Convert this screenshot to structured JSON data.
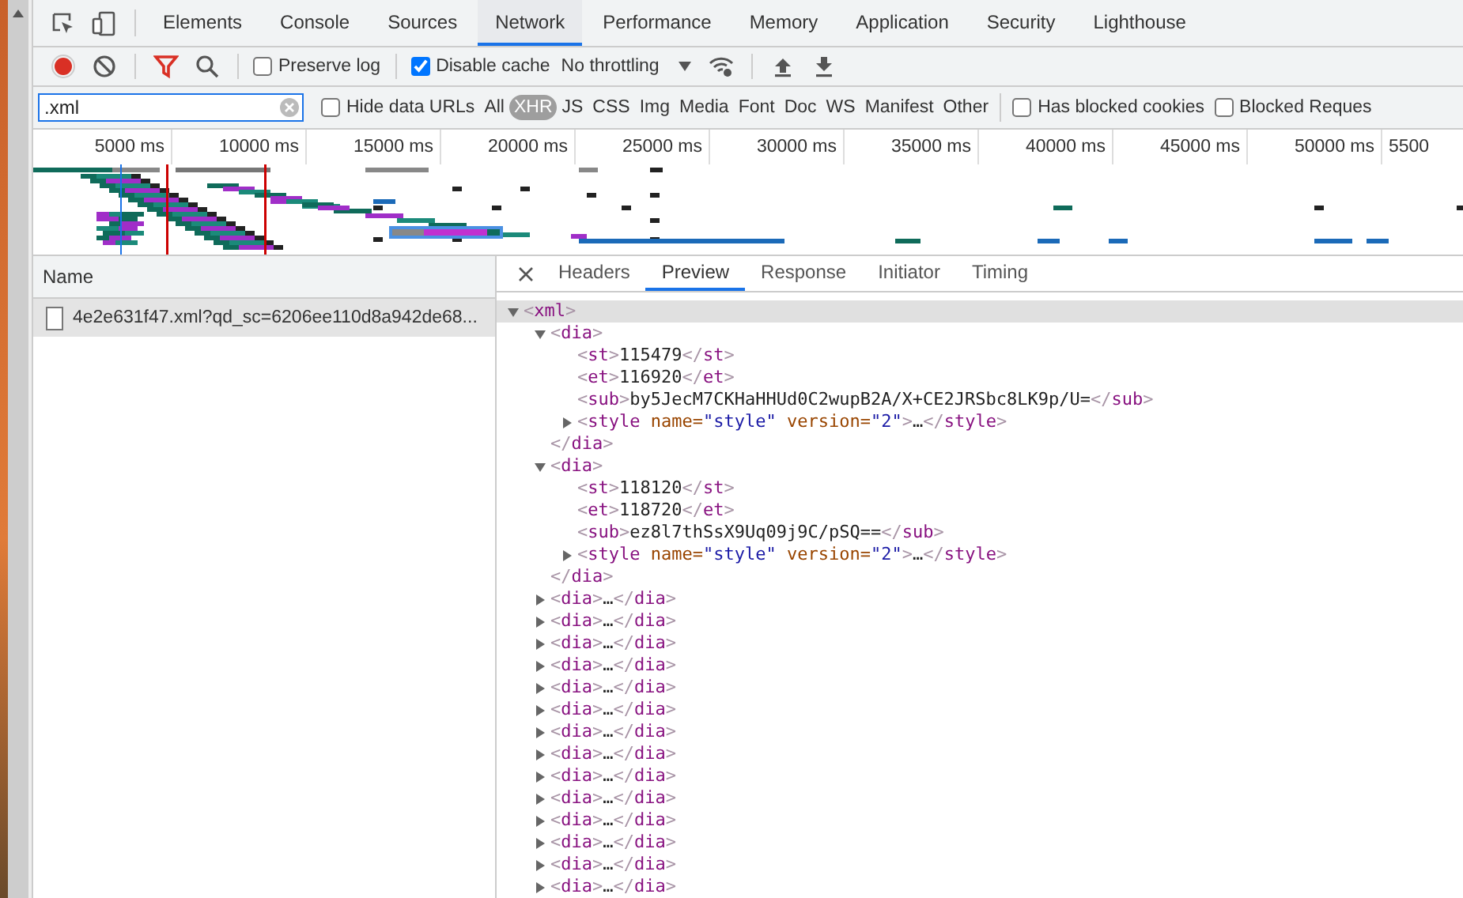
{
  "panel_tabs": [
    {
      "label": "Elements",
      "selected": false
    },
    {
      "label": "Console",
      "selected": false
    },
    {
      "label": "Sources",
      "selected": false
    },
    {
      "label": "Network",
      "selected": true
    },
    {
      "label": "Performance",
      "selected": false
    },
    {
      "label": "Memory",
      "selected": false
    },
    {
      "label": "Application",
      "selected": false
    },
    {
      "label": "Security",
      "selected": false
    },
    {
      "label": "Lighthouse",
      "selected": false
    }
  ],
  "toolbar": {
    "recording": true,
    "filter_active": true,
    "preserve_log": {
      "label": "Preserve log",
      "checked": false
    },
    "disable_cache": {
      "label": "Disable cache",
      "checked": true
    },
    "throttling": "No throttling"
  },
  "filter_bar": {
    "filter": {
      "value": ".xml"
    },
    "hide_data_urls": {
      "label": "Hide data URLs",
      "checked": false
    },
    "types": [
      {
        "label": "All",
        "selected": false
      },
      {
        "label": "XHR",
        "selected": true
      },
      {
        "label": "JS",
        "selected": false
      },
      {
        "label": "CSS",
        "selected": false
      },
      {
        "label": "Img",
        "selected": false
      },
      {
        "label": "Media",
        "selected": false
      },
      {
        "label": "Font",
        "selected": false
      },
      {
        "label": "Doc",
        "selected": false
      },
      {
        "label": "WS",
        "selected": false
      },
      {
        "label": "Manifest",
        "selected": false
      },
      {
        "label": "Other",
        "selected": false
      }
    ],
    "has_blocked_cookies": {
      "label": "Has blocked cookies",
      "checked": false
    },
    "blocked_requests": {
      "label": "Blocked Reques",
      "checked": false
    }
  },
  "overview": {
    "ticks": [
      "5000 ms",
      "10000 ms",
      "15000 ms",
      "20000 ms",
      "25000 ms",
      "30000 ms",
      "35000 ms",
      "40000 ms",
      "45000 ms",
      "50000 ms",
      "5500"
    ]
  },
  "requests": {
    "column": "Name",
    "rows": [
      {
        "name": "4e2e631f47.xml?qd_sc=6206ee110d8a942de68...",
        "selected": true
      }
    ]
  },
  "detail_tabs": [
    {
      "label": "Headers",
      "selected": false
    },
    {
      "label": "Preview",
      "selected": true
    },
    {
      "label": "Response",
      "selected": false
    },
    {
      "label": "Initiator",
      "selected": false
    },
    {
      "label": "Timing",
      "selected": false
    }
  ],
  "preview_tree": [
    {
      "text": "<xml>",
      "expanded": true,
      "selected": true,
      "children": [
        {
          "text": "<dia>",
          "expanded": true,
          "selected": false,
          "close": "</dia>",
          "children": [
            {
              "text": "<st>115479</st>",
              "selected": false
            },
            {
              "text": "<et>116920</et>",
              "selected": false
            },
            {
              "text": "<sub>by5JecM7CKHaHHUd0C2wupB2A/X+CE2JRSbc8LK9p/U=</sub>",
              "selected": false
            },
            {
              "text": "<style name=\"style\" version=\"2\">…</style>",
              "expanded": false,
              "selected": false
            }
          ]
        },
        {
          "text": "<dia>",
          "expanded": true,
          "selected": false,
          "close": "</dia>",
          "children": [
            {
              "text": "<st>118120</st>",
              "selected": false
            },
            {
              "text": "<et>118720</et>",
              "selected": false
            },
            {
              "text": "<sub>ez8l7thSsX9Uq09j9C/pSQ==</sub>",
              "selected": false
            },
            {
              "text": "<style name=\"style\" version=\"2\">…</style>",
              "expanded": false,
              "selected": false
            }
          ]
        },
        {
          "text": "<dia>…</dia>",
          "expanded": false,
          "selected": false
        },
        {
          "text": "<dia>…</dia>",
          "expanded": false,
          "selected": false
        },
        {
          "text": "<dia>…</dia>",
          "expanded": false,
          "selected": false
        },
        {
          "text": "<dia>…</dia>",
          "expanded": false,
          "selected": false
        },
        {
          "text": "<dia>…</dia>",
          "expanded": false,
          "selected": false
        },
        {
          "text": "<dia>…</dia>",
          "expanded": false,
          "selected": false
        },
        {
          "text": "<dia>…</dia>",
          "expanded": false,
          "selected": false
        },
        {
          "text": "<dia>…</dia>",
          "expanded": false,
          "selected": false
        },
        {
          "text": "<dia>…</dia>",
          "expanded": false,
          "selected": false
        },
        {
          "text": "<dia>…</dia>",
          "expanded": false,
          "selected": false
        },
        {
          "text": "<dia>…</dia>",
          "expanded": false,
          "selected": false
        },
        {
          "text": "<dia>…</dia>",
          "expanded": false,
          "selected": false
        },
        {
          "text": "<dia>…</dia>",
          "expanded": false,
          "selected": false
        },
        {
          "text": "<dia>…</dia>",
          "expanded": false,
          "selected": false
        }
      ]
    }
  ]
}
